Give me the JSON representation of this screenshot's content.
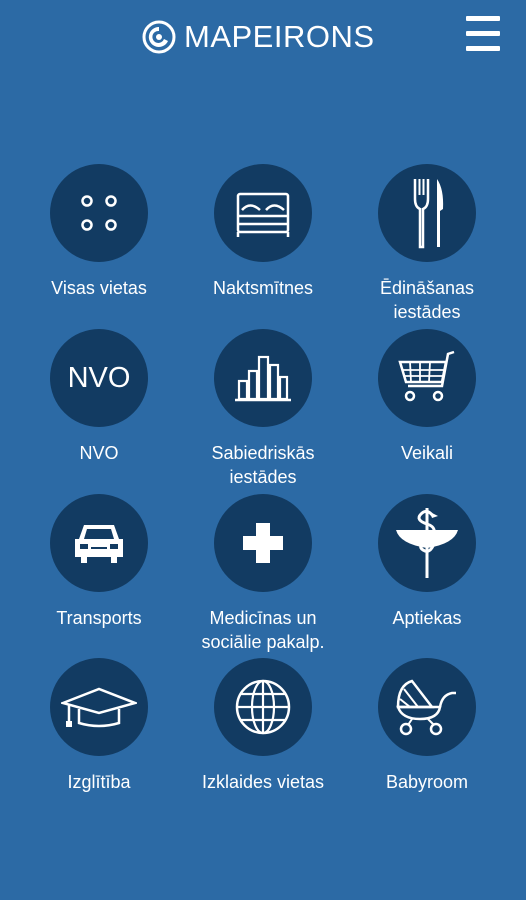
{
  "header": {
    "brand": "MAPEIRONS",
    "logo_icon": "mapeirons-logo-icon",
    "menu_icon": "hamburger-menu-icon"
  },
  "colors": {
    "background": "#2c6aa5",
    "circle": "#123b62",
    "text": "#ffffff"
  },
  "categories": [
    {
      "label": "Visas vietas",
      "icon": "four-dots-icon"
    },
    {
      "label": "Naktsmītnes",
      "icon": "bed-icon"
    },
    {
      "label": "Ēdināšanas\niestādes",
      "icon": "fork-knife-icon"
    },
    {
      "label": "NVO",
      "icon": "nvo-icon",
      "icon_text": "NVO"
    },
    {
      "label": "Sabiedriskās\niestādes",
      "icon": "buildings-icon"
    },
    {
      "label": "Veikali",
      "icon": "shopping-cart-icon"
    },
    {
      "label": "Transports",
      "icon": "car-icon"
    },
    {
      "label": "Medicīnas un\nsociālie pakalp.",
      "icon": "plus-icon"
    },
    {
      "label": "Aptiekas",
      "icon": "pharmacy-icon"
    },
    {
      "label": "Izglītība",
      "icon": "graduation-cap-icon"
    },
    {
      "label": "Izklaides vietas",
      "icon": "globe-icon"
    },
    {
      "label": "Babyroom",
      "icon": "baby-stroller-icon"
    }
  ]
}
